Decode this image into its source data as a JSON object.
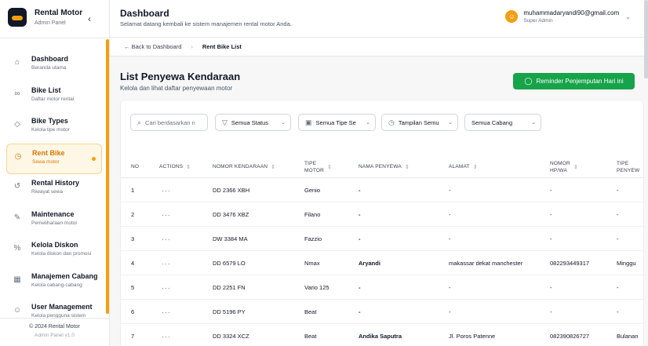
{
  "sidebar": {
    "brand_title": "Rental Motor",
    "brand_sub": "Admin Panel",
    "items": [
      {
        "label": "Dashboard",
        "desc": "Beranda utama",
        "icon": "home-icon",
        "glyph": "⌂"
      },
      {
        "label": "Bike List",
        "desc": "Daftar motor rental",
        "icon": "bike-icon",
        "glyph": "∞"
      },
      {
        "label": "Bike Types",
        "desc": "Kelola tipe motor",
        "icon": "tag-icon",
        "glyph": "◇"
      },
      {
        "label": "Rent Bike",
        "desc": "Sewa motor",
        "icon": "clock-icon",
        "glyph": "◷"
      },
      {
        "label": "Rental History",
        "desc": "Riwayat sewa",
        "icon": "history-icon",
        "glyph": "↺"
      },
      {
        "label": "Maintenance",
        "desc": "Pemeliharaan motor",
        "icon": "wrench-icon",
        "glyph": "✎"
      },
      {
        "label": "Kelola Diskon",
        "desc": "Kelola diskon dan promosi",
        "icon": "percent-icon",
        "glyph": "%"
      },
      {
        "label": "Manajemen Cabang",
        "desc": "Kelola cabang-cabang",
        "icon": "building-icon",
        "glyph": "▦"
      },
      {
        "label": "User Management",
        "desc": "Kelola pengguna sistem",
        "icon": "users-icon",
        "glyph": "☺"
      }
    ],
    "footer_copy": "© 2024 Rental Motor",
    "footer_version": "Admin Panel v1.0"
  },
  "header": {
    "title": "Dashboard",
    "subtitle": "Selamat datang kembali ke sistem manajemen rental motor Anda.",
    "user_email": "muhammadaryandi90@gmail.com",
    "user_role": "Super Admin"
  },
  "breadcrumb": {
    "back": "Back to Dashboard",
    "current": "Rent Bike List"
  },
  "main": {
    "title": "List Penyewa Kendaraan",
    "subtitle": "Kelola dan lihat daftar penyewaan motor",
    "reminder_button": "Reminder Penjemputan Hari ini"
  },
  "filters": {
    "search_placeholder": "Cari berdasarkan n",
    "status": "Semua Status",
    "tipe": "Semua Tipe Se",
    "tampilan": "Tampilan Semu",
    "cabang": "Semua Cabang"
  },
  "table": {
    "headers": {
      "no": "NO",
      "actions": "ACTIONS",
      "nomor": "NOMOR KENDARAAN",
      "tipe_l1": "TIPE",
      "tipe_l2": "MOTOR",
      "nama": "NAMA PENYEWA",
      "alamat": "ALAMAT",
      "hp_l1": "NOMOR",
      "hp_l2": "HP/WA",
      "tipe_penyewa_l1": "TIPE",
      "tipe_penyewa_l2": "PENYEW"
    },
    "rows": [
      {
        "no": "1",
        "nomor": "DD 2366 XBH",
        "tipe": "Genio",
        "nama": "-",
        "alamat": "-",
        "hp": "-",
        "tp": "-"
      },
      {
        "no": "2",
        "nomor": "DD 3476 XBZ",
        "tipe": "Filano",
        "nama": "-",
        "alamat": "-",
        "hp": "-",
        "tp": "-"
      },
      {
        "no": "3",
        "nomor": "DW 3384 MA",
        "tipe": "Fazzio",
        "nama": "-",
        "alamat": "-",
        "hp": "-",
        "tp": "-"
      },
      {
        "no": "4",
        "nomor": "DD 6579 LO",
        "tipe": "Nmax",
        "nama": "Aryandi",
        "alamat": "makassar dekat manchester",
        "hp": "082293449317",
        "tp": "Minggu"
      },
      {
        "no": "5",
        "nomor": "DD 2251 FN",
        "tipe": "Vario 125",
        "nama": "-",
        "alamat": "-",
        "hp": "-",
        "tp": "-"
      },
      {
        "no": "6",
        "nomor": "DD 5196 PY",
        "tipe": "Beat",
        "nama": "-",
        "alamat": "-",
        "hp": "-",
        "tp": "-"
      },
      {
        "no": "7",
        "nomor": "DD 3324 XCZ",
        "tipe": "Beat",
        "nama": "Andika Saputra",
        "alamat": "Jl. Poros Patenne",
        "hp": "082390826727",
        "tp": "Bulanan"
      }
    ]
  },
  "colors": {
    "accent": "#f59e0b",
    "green": "#16a34a"
  }
}
